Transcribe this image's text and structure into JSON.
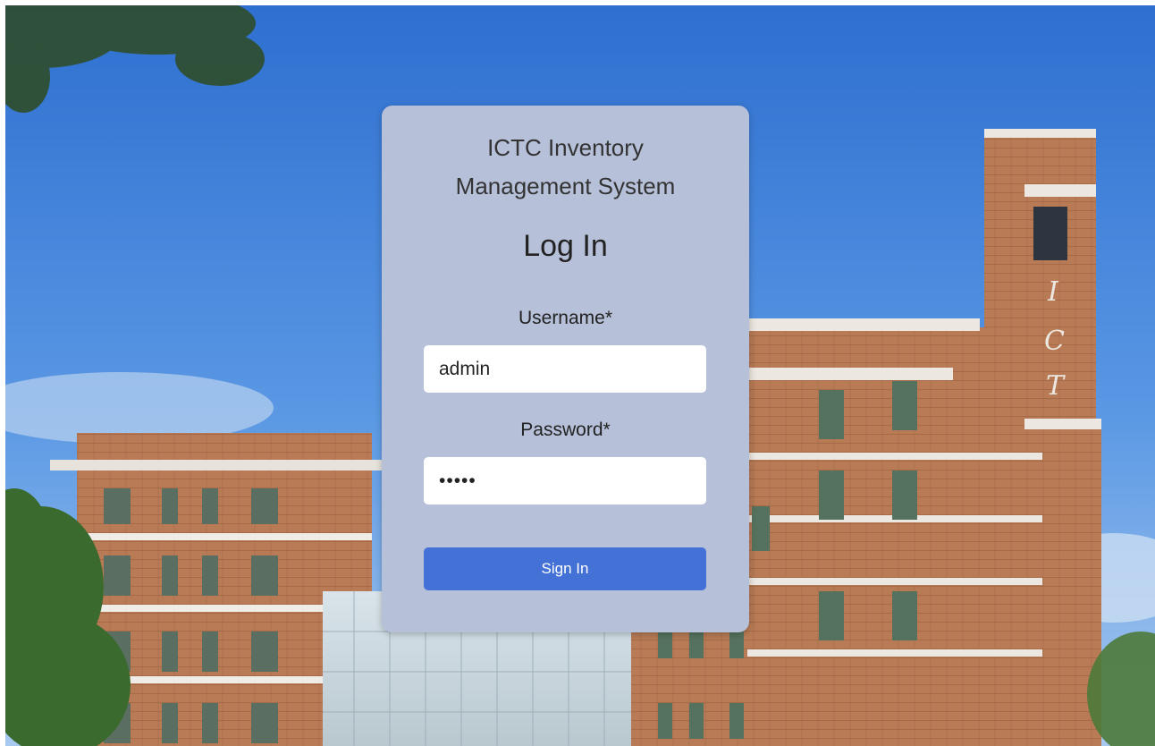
{
  "app": {
    "title": "ICTC Inventory Management System"
  },
  "login": {
    "heading": "Log In",
    "username_label": "Username*",
    "username_value": "admin",
    "password_label": "Password*",
    "password_value": "admin",
    "submit_label": "Sign In"
  },
  "background": {
    "description_icon": "campus-building-photo"
  },
  "colors": {
    "card_bg": "#b6c0d8",
    "button_bg": "#4471d6",
    "sky": "#3f7fd8"
  }
}
